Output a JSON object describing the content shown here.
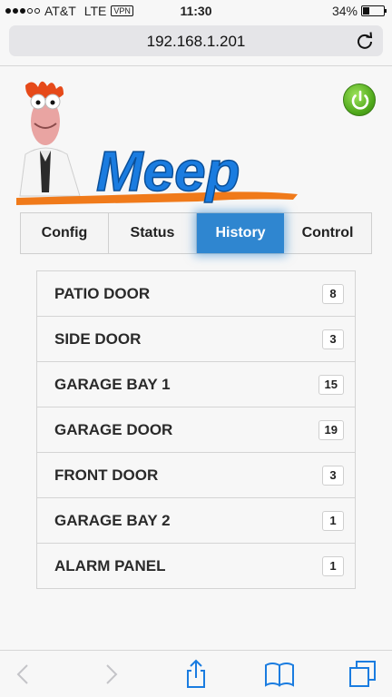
{
  "status_bar": {
    "carrier": "AT&T",
    "network": "LTE",
    "vpn": "VPN",
    "time": "11:30",
    "battery_text": "34%",
    "battery_level": 0.34
  },
  "url_bar": {
    "url": "192.168.1.201"
  },
  "header": {
    "logo_text": "Meep"
  },
  "tabs": [
    {
      "label": "Config",
      "active": false
    },
    {
      "label": "Status",
      "active": false
    },
    {
      "label": "History",
      "active": true
    },
    {
      "label": "Control",
      "active": false
    }
  ],
  "items": [
    {
      "label": "PATIO DOOR",
      "count": "8"
    },
    {
      "label": "SIDE DOOR",
      "count": "3"
    },
    {
      "label": "GARAGE BAY 1",
      "count": "15"
    },
    {
      "label": "GARAGE DOOR",
      "count": "19"
    },
    {
      "label": "FRONT DOOR",
      "count": "3"
    },
    {
      "label": "GARAGE BAY 2",
      "count": "1"
    },
    {
      "label": "ALARM PANEL",
      "count": "1"
    }
  ],
  "colors": {
    "accent": "#2f86d0",
    "power": "#4ea71a",
    "ios_blue": "#1a7ce0",
    "logo_orange": "#f07a1a"
  },
  "icons": {
    "reload": "reload-icon",
    "power": "power-icon",
    "back": "chevron-left-icon",
    "forward": "chevron-right-icon",
    "share": "share-icon",
    "bookmarks": "book-icon",
    "tabs": "tabs-icon"
  }
}
